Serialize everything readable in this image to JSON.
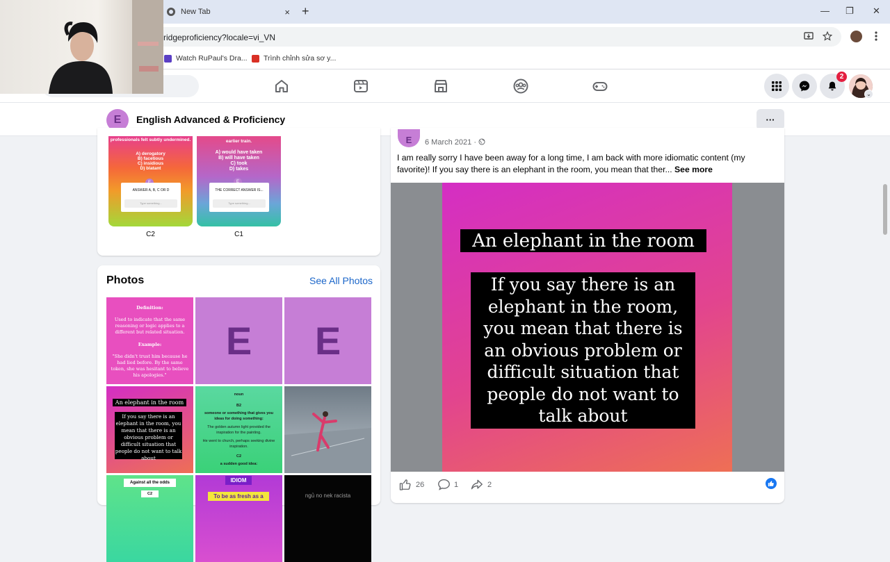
{
  "browser": {
    "tab_title": "New Tab",
    "tab_close": "×",
    "new_tab": "+",
    "window_controls": [
      "—",
      "❐",
      "✕"
    ],
    "url": "ridgeproficiency?locale=vi_VN",
    "bookmarks": [
      {
        "label": "Watch RuPaul's Dra...",
        "color": "#5b3fc4"
      },
      {
        "label": "Trình chỉnh sửa sơ y...",
        "color": "#d93025"
      }
    ]
  },
  "facebook_nav": {
    "icons": [
      "home-icon",
      "watch-icon",
      "marketplace-icon",
      "groups-icon",
      "gaming-icon"
    ],
    "notification_count": "2"
  },
  "group": {
    "avatar_letter": "E",
    "name": "English Advanced & Proficiency",
    "more": "···"
  },
  "stories": [
    {
      "label": "C2",
      "question_tail": "professionals felt subtly undermined.",
      "options": [
        "A) derogatory",
        "B) facetious",
        "C) insidious",
        "D) blatant"
      ],
      "answer_prompt": "ANSWER A, B, C OR D",
      "input_placeholder": "Type something...",
      "gradient": [
        "#e7408c",
        "#f28b2d",
        "#9fd63a"
      ]
    },
    {
      "label": "C1",
      "question_tail": "earlier train.",
      "options": [
        "A) would have taken",
        "B) will have taken",
        "C) took",
        "D) takes"
      ],
      "answer_prompt": "THE CORRECT ANSWER IS...",
      "input_placeholder": "Type something...",
      "gradient": [
        "#e44a8a",
        "#b467c9",
        "#35c0a5"
      ]
    }
  ],
  "photos": {
    "title": "Photos",
    "see_all": "See All Photos",
    "items": [
      {
        "kind": "definition",
        "heading": "Definition:",
        "text": "Used to indicate that the same reasoning or logic applies to a different but related situation.",
        "example_label": "Example:",
        "example": "\"She didn't trust him because he had lied before. By the same token, she was hesitant to believe his apologies.\""
      },
      {
        "kind": "logo",
        "letter": "E"
      },
      {
        "kind": "logo",
        "letter": "E"
      },
      {
        "kind": "idiom-card",
        "title": "An elephant in the room",
        "text": "If you say there is an elephant in the room, you mean that there is an obvious problem or difficult situation that people do not want to talk about"
      },
      {
        "kind": "vocab",
        "pos": "noun",
        "level": "B2",
        "text": "someone or something that gives you ideas for doing something:",
        "ex1": "The golden autumn light provided the inspiration for the painting.",
        "ex2": "He went to church, perhaps seeking divine inspiration.",
        "level2": "C2",
        "text2": "a sudden good idea:"
      },
      {
        "kind": "photo"
      },
      {
        "kind": "banner",
        "text": "Against all the odds",
        "level": "C2"
      },
      {
        "kind": "banner2",
        "tag": "IDIOM",
        "text": "To be as fresh as a"
      },
      {
        "kind": "dark",
        "text": "ngủ no nek racista"
      }
    ]
  },
  "post": {
    "avatar_letter": "E",
    "date": "6 March 2021 ·",
    "body": "I am really sorry I have been away for a long time, I am back with more idiomatic content (my favorite)! If you say there is an elephant in the room, you mean that ther...",
    "see_more": "See more",
    "image_title": "An elephant in the room",
    "image_definition": "If you say there is an elephant in the room, you mean that there is an obvious problem or difficult situation that people do not want to talk about",
    "likes": "26",
    "comments": "1",
    "shares": "2"
  }
}
